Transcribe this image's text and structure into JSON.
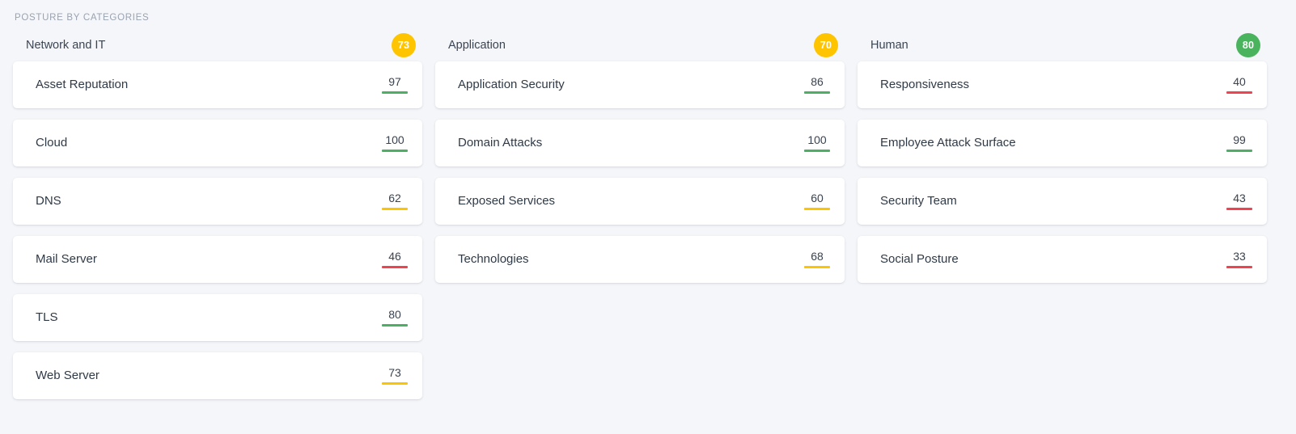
{
  "panel": {
    "title": "POSTURE BY CATEGORIES"
  },
  "colors": {
    "green": "#4caf64",
    "yellow": "#fdc500",
    "red": "#ef4450",
    "badge_green": "#49b35e",
    "badge_yellow": "#ffc400",
    "background": "#f4f6f9",
    "card_background": "#ffffff"
  },
  "columns": [
    {
      "title": "Network and IT",
      "score": "73",
      "score_color": "yellow",
      "items": [
        {
          "label": "Asset Reputation",
          "score": "97",
          "color": "green"
        },
        {
          "label": "Cloud",
          "score": "100",
          "color": "green"
        },
        {
          "label": "DNS",
          "score": "62",
          "color": "yellow"
        },
        {
          "label": "Mail Server",
          "score": "46",
          "color": "red"
        },
        {
          "label": "TLS",
          "score": "80",
          "color": "green"
        },
        {
          "label": "Web Server",
          "score": "73",
          "color": "yellow"
        }
      ]
    },
    {
      "title": "Application",
      "score": "70",
      "score_color": "yellow",
      "items": [
        {
          "label": "Application Security",
          "score": "86",
          "color": "green"
        },
        {
          "label": "Domain Attacks",
          "score": "100",
          "color": "green"
        },
        {
          "label": "Exposed Services",
          "score": "60",
          "color": "yellow"
        },
        {
          "label": "Technologies",
          "score": "68",
          "color": "yellow"
        }
      ]
    },
    {
      "title": "Human",
      "score": "80",
      "score_color": "green",
      "items": [
        {
          "label": "Responsiveness",
          "score": "40",
          "color": "red"
        },
        {
          "label": "Employee Attack Surface",
          "score": "99",
          "color": "green"
        },
        {
          "label": "Security Team",
          "score": "43",
          "color": "red"
        },
        {
          "label": "Social Posture",
          "score": "33",
          "color": "red"
        }
      ]
    }
  ]
}
